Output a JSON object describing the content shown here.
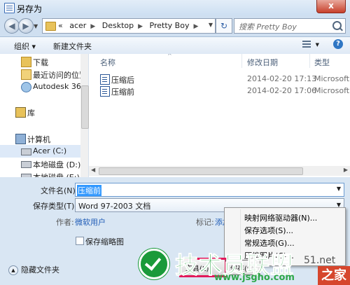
{
  "window": {
    "title": "另存为",
    "close_label": "x"
  },
  "nav": {
    "breadcrumbs": [
      "«",
      "acer",
      "Desktop",
      "Pretty Boy"
    ],
    "search_placeholder": "搜索 Pretty Boy"
  },
  "toolbar": {
    "organize_label": "组织 ▾",
    "new_folder_label": "新建文件夹"
  },
  "sidebar": {
    "items": [
      {
        "label": "下载",
        "icon": "download-folder-icon"
      },
      {
        "label": "最近访问的位置",
        "icon": "recent-places-icon"
      },
      {
        "label": "Autodesk 360",
        "icon": "cloud-icon"
      },
      {
        "label": "库",
        "icon": "library-icon"
      },
      {
        "label": "计算机",
        "icon": "computer-icon"
      },
      {
        "label": "Acer (C:)",
        "icon": "drive-icon"
      },
      {
        "label": "本地磁盘 (D:)",
        "icon": "drive-icon"
      },
      {
        "label": "本地磁盘 (E:)",
        "icon": "drive-icon"
      }
    ]
  },
  "files": {
    "columns": {
      "name": "名称",
      "date": "修改日期",
      "type": "类型"
    },
    "rows": [
      {
        "name": "压缩后",
        "date": "2014-02-20 17:13",
        "type": "Microsoft"
      },
      {
        "name": "压缩前",
        "date": "2014-02-20 17:06",
        "type": "Microsoft"
      }
    ]
  },
  "form": {
    "filename_label": "文件名(N):",
    "filename_value": "压缩前",
    "filetype_label": "保存类型(T):",
    "filetype_value": "Word 97-2003 文档",
    "author_label": "作者:",
    "author_value": "微软用户",
    "tags_label": "标记:",
    "tags_value": "添加",
    "thumbnail_label": "保存缩略图",
    "hide_folders_label": "隐藏文件夹"
  },
  "tools_menu": {
    "items": [
      "映射网络驱动器(N)...",
      "保存选项(S)...",
      "常规选项(G)...",
      "压缩图片(C)..."
    ]
  },
  "buttons": {
    "tools_label": "工具(L)",
    "save_label": "保存(S)"
  },
  "watermark": {
    "brand": "技术员联盟",
    "url": "www.jsgho.com",
    "corner_text": "51.net",
    "home_text": "之家"
  },
  "colors": {
    "accent": "#3399ff",
    "watermark_green": "#2ea849",
    "highlight_box": "#e2195a"
  }
}
